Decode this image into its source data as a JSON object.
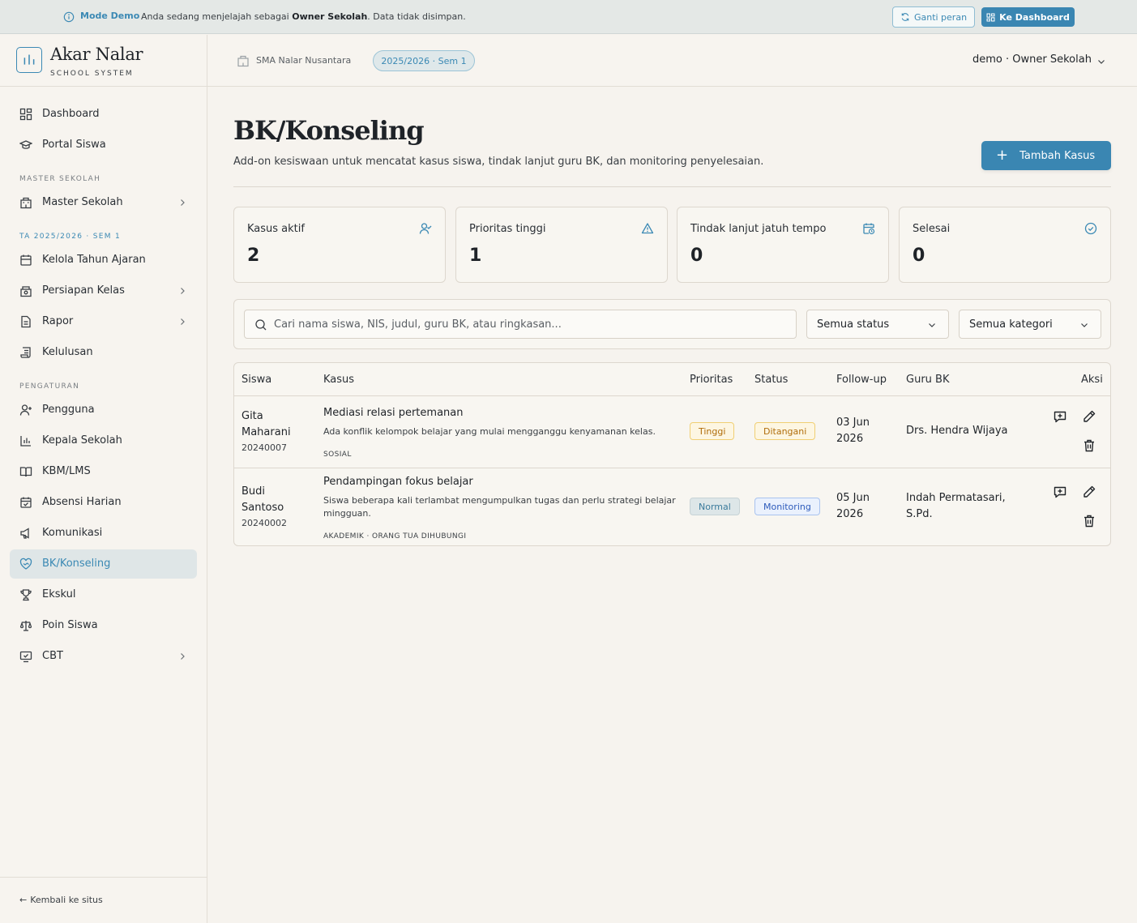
{
  "demo": {
    "label": "Mode Demo",
    "text_prefix": "Anda sedang menjelajah sebagai ",
    "text_role": "Owner Sekolah",
    "text_suffix": ". Data tidak disimpan.",
    "switch_role": "Ganti peran",
    "to_dashboard": "Ke Dashboard"
  },
  "brand": {
    "name": "Akar Nalar",
    "sub": "SCHOOL SYSTEM"
  },
  "sidebar": {
    "items_top": [
      {
        "label": "Dashboard",
        "icon": "dashboard-icon"
      },
      {
        "label": "Portal Siswa",
        "icon": "graduation-cap-icon"
      }
    ],
    "section_master": "MASTER SEKOLAH",
    "items_master": [
      {
        "label": "Master Sekolah",
        "icon": "school-building-icon"
      }
    ],
    "section_ta": "TA 2025/2026 · SEM 1",
    "items_ta": [
      {
        "label": "Kelola Tahun Ajaran",
        "icon": "calendar-icon"
      },
      {
        "label": "Persiapan Kelas",
        "icon": "classroom-icon"
      },
      {
        "label": "Rapor",
        "icon": "document-icon"
      },
      {
        "label": "Kelulusan",
        "icon": "scroll-icon"
      }
    ],
    "section_settings": "PENGATURAN",
    "items_settings": [
      {
        "label": "Pengguna",
        "icon": "user-plus-icon"
      },
      {
        "label": "Kepala Sekolah",
        "icon": "bar-chart-icon"
      },
      {
        "label": "KBM/LMS",
        "icon": "book-open-icon"
      },
      {
        "label": "Absensi Harian",
        "icon": "calendar-check-icon"
      },
      {
        "label": "Komunikasi",
        "icon": "megaphone-icon"
      },
      {
        "label": "BK/Konseling",
        "icon": "heart-handshake-icon"
      },
      {
        "label": "Ekskul",
        "icon": "trophy-icon"
      },
      {
        "label": "Poin Siswa",
        "icon": "scale-icon"
      },
      {
        "label": "CBT",
        "icon": "monitor-check-icon"
      }
    ],
    "back": "Kembali ke situs"
  },
  "topbar": {
    "school": "SMA Nalar Nusantara",
    "year": "2025/2026 · Sem 1",
    "user": "demo · Owner Sekolah"
  },
  "page": {
    "title": "BK/Konseling",
    "desc": "Add-on kesiswaan untuk mencatat kasus siswa, tindak lanjut guru BK, dan monitoring penyelesaian.",
    "add_button": "Tambah Kasus"
  },
  "stats": [
    {
      "label": "Kasus aktif",
      "value": "2"
    },
    {
      "label": "Prioritas tinggi",
      "value": "1"
    },
    {
      "label": "Tindak lanjut jatuh tempo",
      "value": "0"
    },
    {
      "label": "Selesai",
      "value": "0"
    }
  ],
  "filters": {
    "search_placeholder": "Cari nama siswa, NIS, judul, guru BK, atau ringkasan...",
    "status": "Semua status",
    "category": "Semua kategori"
  },
  "table": {
    "headers": [
      "Siswa",
      "Kasus",
      "Prioritas",
      "Status",
      "Follow-up",
      "Guru BK",
      "Aksi"
    ],
    "rows": [
      {
        "name_1": "Gita",
        "name_2": "Maharani",
        "nis": "20240007",
        "title": "Mediasi relasi pertemanan",
        "summary_1": "Ada konflik kelompok belajar yang mulai mengganggu kenyamanan kelas.",
        "summary_2": "",
        "tags": "SOSIAL",
        "priority": "Tinggi",
        "status": "Ditangani",
        "follow_1": "03 Jun",
        "follow_2": "2026",
        "teacher_1": "Drs. Hendra Wijaya",
        "teacher_2": ""
      },
      {
        "name_1": "Budi",
        "name_2": "Santoso",
        "nis": "20240002",
        "title": "Pendampingan fokus belajar",
        "summary_1": "Siswa beberapa kali terlambat mengumpulkan tugas dan perlu strategi belajar",
        "summary_2": "mingguan.",
        "tags": "AKADEMIK · ORANG TUA DIHUBUNGI",
        "priority": "Normal",
        "status": "Monitoring",
        "follow_1": "05 Jun",
        "follow_2": "2026",
        "teacher_1": "Indah Permatasari,",
        "teacher_2": "S.Pd."
      }
    ]
  },
  "colors": {
    "accent": "#3a86b2",
    "background": "#f6f3ee"
  }
}
